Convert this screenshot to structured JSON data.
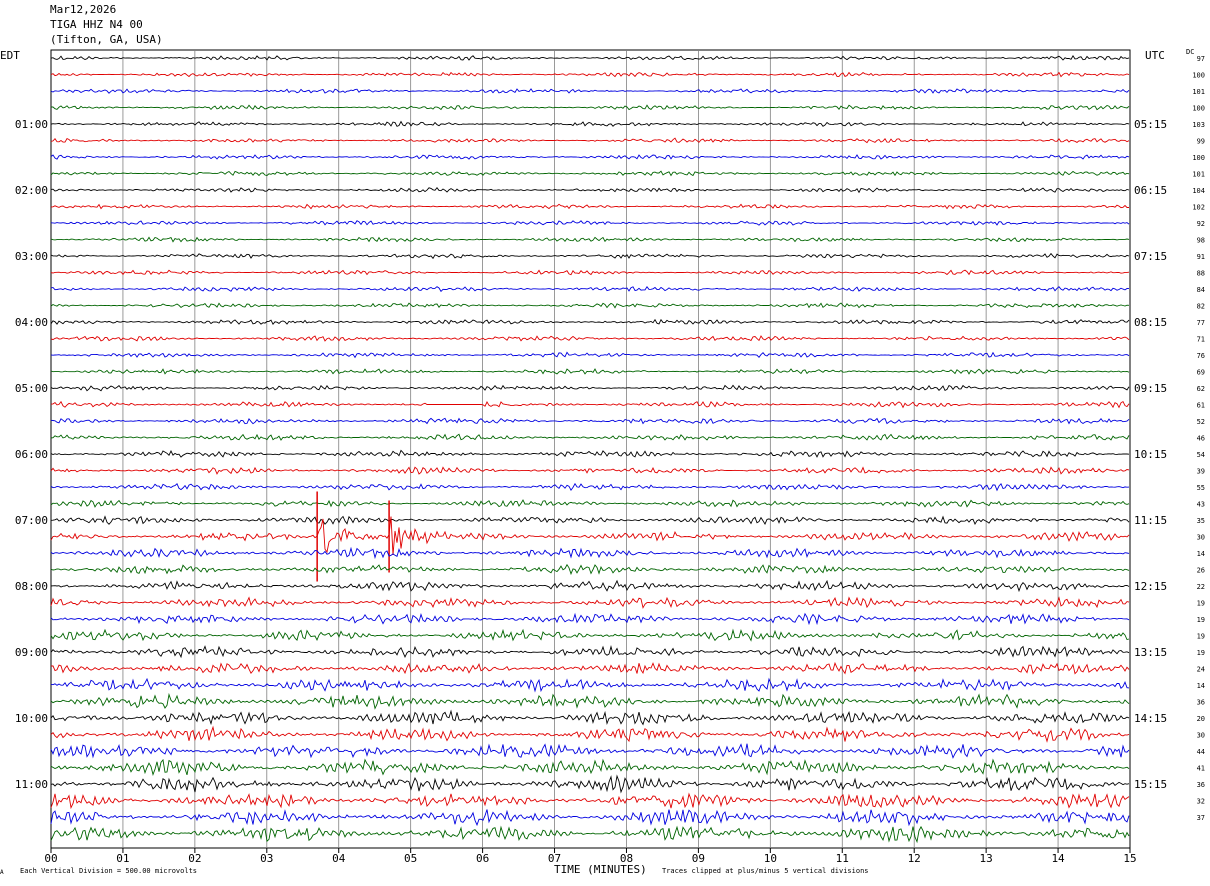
{
  "header": {
    "date": "Mar12,2026",
    "station": "TIGA HHZ N4 00",
    "location": "(Tifton, GA, USA)"
  },
  "left_tz": "EDT",
  "right_tz": "UTC",
  "dc_label": "DC",
  "footer": {
    "scale_note": "Each Vertical Division =  500.00 microvolts",
    "clip_note": "Traces clipped at plus/minus 5 vertical divisions",
    "mark": "A"
  },
  "colors": {
    "trace_cycle": [
      "#000000",
      "#e00000",
      "#0000e0",
      "#006400"
    ],
    "grid": "#808080"
  },
  "chart_data": {
    "type": "line",
    "title": "TIGA HHZ N4 00",
    "xlabel": "TIME (MINUTES)",
    "xlim": [
      0,
      15
    ],
    "x_ticks": [
      "00",
      "01",
      "02",
      "03",
      "04",
      "05",
      "06",
      "07",
      "08",
      "09",
      "10",
      "11",
      "12",
      "13",
      "14",
      "15"
    ],
    "rows_per_hour": 4,
    "minutes_per_row": 15,
    "row_count": 48,
    "left_hour_labels": [
      "01:00",
      "02:00",
      "03:00",
      "04:00",
      "05:00",
      "06:00",
      "07:00",
      "08:00",
      "09:00",
      "10:00",
      "11:00"
    ],
    "right_hour_labels": [
      "05:15",
      "06:15",
      "07:15",
      "08:15",
      "09:15",
      "10:15",
      "11:15",
      "12:15",
      "13:15",
      "14:15",
      "15:15"
    ],
    "dc_offsets": [
      97,
      100,
      101,
      100,
      103,
      99,
      100,
      101,
      104,
      102,
      92,
      98,
      91,
      88,
      84,
      82,
      77,
      71,
      76,
      69,
      62,
      61,
      52,
      46,
      54,
      39,
      55,
      43,
      35,
      30,
      14,
      26,
      22,
      19,
      19,
      19,
      19,
      24,
      14,
      36,
      20,
      30,
      44,
      41,
      36,
      32,
      37
    ],
    "noise_level_by_row": [
      0.3,
      0.3,
      0.3,
      0.3,
      0.3,
      0.3,
      0.3,
      0.3,
      0.3,
      0.3,
      0.3,
      0.3,
      0.35,
      0.35,
      0.35,
      0.35,
      0.4,
      0.4,
      0.4,
      0.4,
      0.45,
      0.5,
      0.6,
      0.6,
      0.7,
      0.7,
      0.7,
      0.8,
      1.0,
      1.1,
      1.2,
      1.2,
      1.3,
      1.3,
      1.4,
      1.5,
      1.6,
      1.7,
      1.8,
      2.0,
      2.1,
      2.0,
      2.2,
      2.3,
      2.3,
      2.4,
      2.4,
      2.5
    ],
    "events": [
      {
        "row": 29,
        "minute": 3.7,
        "amplitude": 5,
        "label": ""
      },
      {
        "row": 29,
        "minute": 4.7,
        "amplitude": 4,
        "label": ""
      }
    ],
    "gap": {
      "row": 21,
      "start_minute": 5.2,
      "end_minute": 6.0
    }
  }
}
